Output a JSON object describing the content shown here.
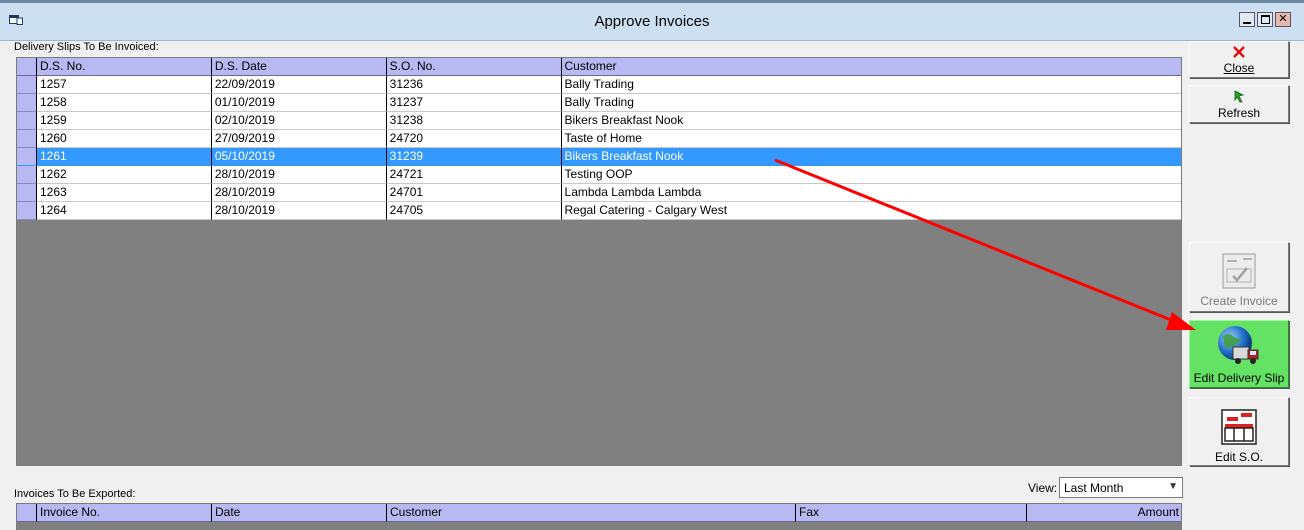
{
  "window": {
    "title": "Approve Invoices"
  },
  "delivery_slips": {
    "label": "Delivery Slips To Be Invoiced:",
    "columns": [
      "D.S. No.",
      "D.S. Date",
      "S.O. No.",
      "Customer"
    ],
    "rows": [
      [
        "1257",
        "22/09/2019",
        "31236",
        "Bally Trading"
      ],
      [
        "1258",
        "01/10/2019",
        "31237",
        "Bally Trading"
      ],
      [
        "1259",
        "02/10/2019",
        "31238",
        "Bikers Breakfast Nook"
      ],
      [
        "1260",
        "27/09/2019",
        "24720",
        "Taste of Home"
      ],
      [
        "1261",
        "05/10/2019",
        "31239",
        "Bikers Breakfast Nook"
      ],
      [
        "1262",
        "28/10/2019",
        "24721",
        "Testing OOP"
      ],
      [
        "1263",
        "28/10/2019",
        "24701",
        "Lambda Lambda Lambda"
      ],
      [
        "1264",
        "28/10/2019",
        "24705",
        "Regal Catering - Calgary West"
      ]
    ],
    "selected_row_index": 4
  },
  "invoices": {
    "label": "Invoices To Be Exported:",
    "columns": [
      "Invoice No.",
      "Date",
      "Customer",
      "Fax",
      "Amount"
    ],
    "view_label": "View:",
    "view_value": "Last Month"
  },
  "buttons": {
    "close": "Close",
    "refresh": "Refresh",
    "create_invoice": "Create Invoice",
    "edit_delivery_slip": "Edit Delivery Slip",
    "edit_so": "Edit S.O."
  },
  "colors": {
    "selection": "#3399ff",
    "grid_header": "#b8b8f2",
    "highlight_button": "#63e263",
    "annotation_arrow": "#ff0000"
  }
}
